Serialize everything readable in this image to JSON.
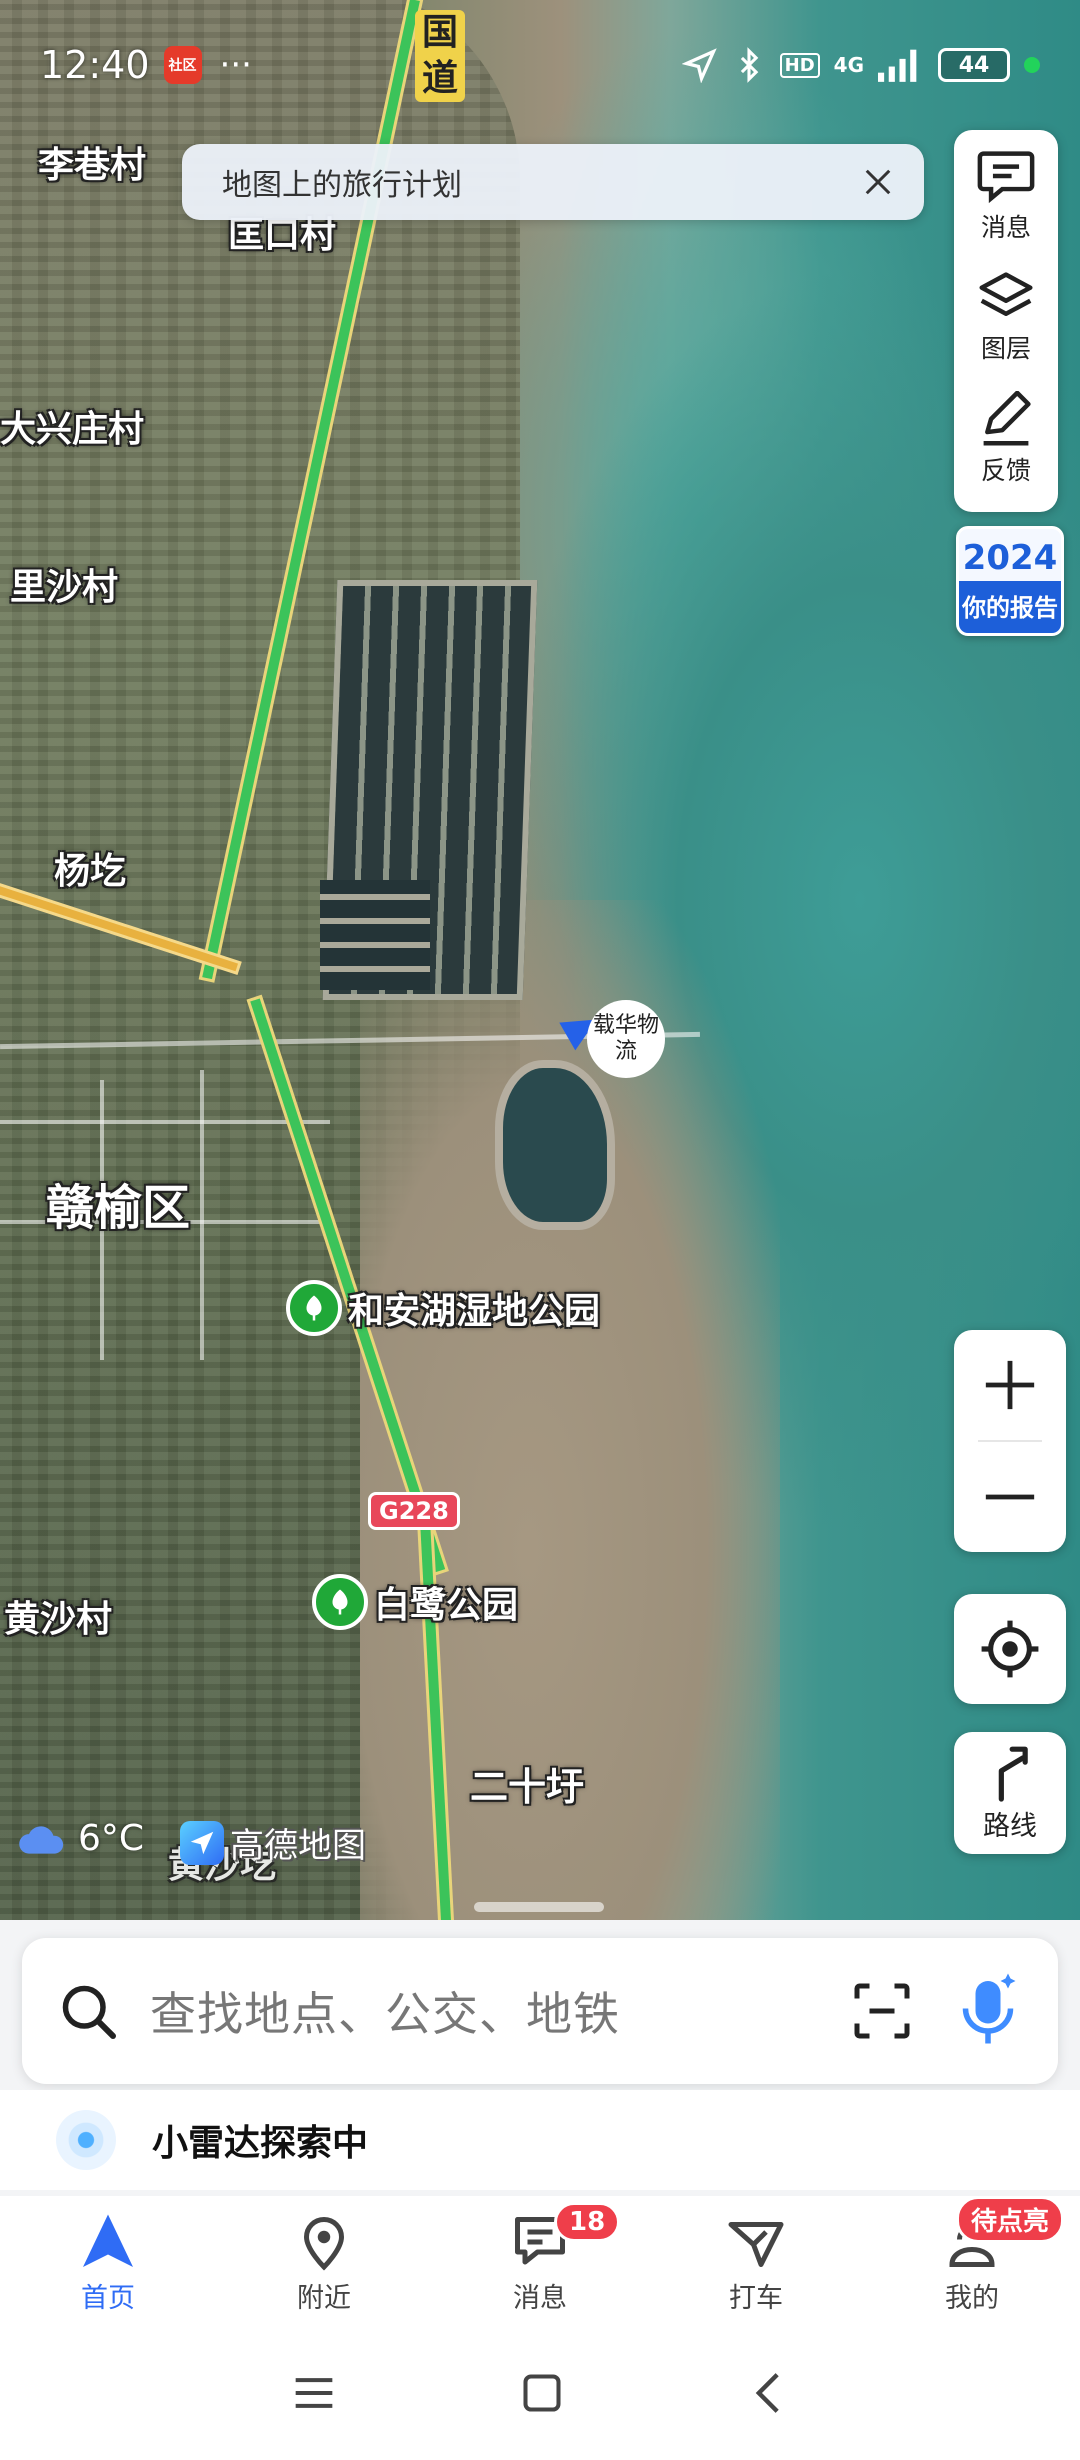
{
  "status_bar": {
    "time": "12:40",
    "app_badge": "社区",
    "more": "···",
    "network": "4G",
    "hd": "HD",
    "battery": "44"
  },
  "banner": {
    "text": "地图上的旅行计划"
  },
  "tools": {
    "message": "消息",
    "layers": "图层",
    "feedback": "反馈"
  },
  "report": {
    "year": "2024",
    "label": "你的报告"
  },
  "map_labels": {
    "road_sign": "国道",
    "village_1": "李巷村",
    "village_2": "匡口村",
    "village_3": "大兴庄村",
    "village_4": "里沙村",
    "village_5": "杨圪",
    "district": "赣榆区",
    "park_1": "和安湖湿地公园",
    "park_2": "白鹭公园",
    "village_6": "黄沙村",
    "place_1": "二十圩",
    "place_2": "黄沙圪",
    "highway": "G228",
    "location_marker": "载华物流"
  },
  "weather": {
    "temp": "6°C",
    "icon": "cloud-icon"
  },
  "map_brand": "高德地图",
  "route_button": "路线",
  "search": {
    "placeholder": "查找地点、公交、地铁"
  },
  "radar": {
    "text": "小雷达探索中"
  },
  "nav": {
    "home": "首页",
    "nearby": "附近",
    "messages": "消息",
    "messages_badge": "18",
    "taxi": "打车",
    "mine": "我的",
    "mine_badge": "待点亮"
  },
  "colors": {
    "accent": "#2f6cf5",
    "badge": "#ef3e4a",
    "poi_green": "#20a838"
  }
}
